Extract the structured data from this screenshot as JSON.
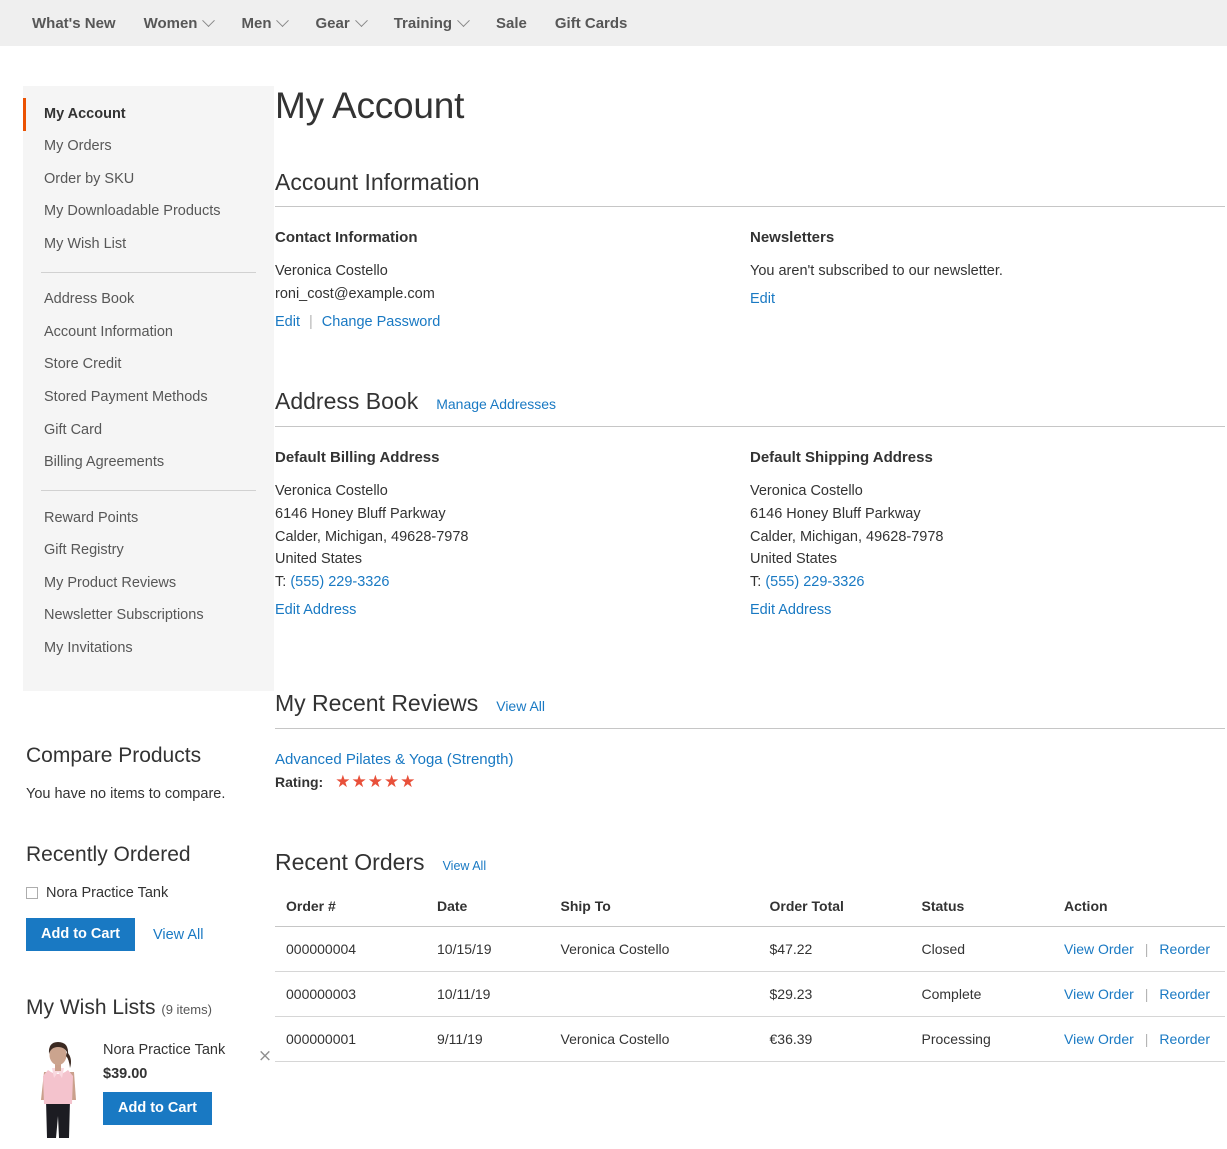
{
  "topnav": {
    "items": [
      {
        "label": "What's New",
        "has_caret": false
      },
      {
        "label": "Women",
        "has_caret": true
      },
      {
        "label": "Men",
        "has_caret": true
      },
      {
        "label": "Gear",
        "has_caret": true
      },
      {
        "label": "Training",
        "has_caret": true
      },
      {
        "label": "Sale",
        "has_caret": false
      },
      {
        "label": "Gift Cards",
        "has_caret": false
      }
    ]
  },
  "account_nav": {
    "group1": [
      "My Account",
      "My Orders",
      "Order by SKU",
      "My Downloadable Products",
      "My Wish List"
    ],
    "group2": [
      "Address Book",
      "Account Information",
      "Store Credit",
      "Stored Payment Methods",
      "Gift Card",
      "Billing Agreements"
    ],
    "group3": [
      "Reward Points",
      "Gift Registry",
      "My Product Reviews",
      "Newsletter Subscriptions",
      "My Invitations"
    ],
    "current": "My Account"
  },
  "compare": {
    "title": "Compare Products",
    "empty_text": "You have no items to compare."
  },
  "recently_ordered": {
    "title": "Recently Ordered",
    "items": [
      {
        "name": "Nora Practice Tank",
        "checked": false
      }
    ],
    "add_to_cart_label": "Add to Cart",
    "view_all_label": "View All"
  },
  "wish_lists": {
    "title": "My Wish Lists",
    "count_label": "(9 items)",
    "items": [
      {
        "name": "Nora Practice Tank",
        "price": "$39.00",
        "add_to_cart_label": "Add to Cart",
        "remove_icon": "×"
      }
    ]
  },
  "main": {
    "page_title": "My Account",
    "account_information": {
      "heading": "Account Information",
      "contact": {
        "title": "Contact Information",
        "name": "Veronica Costello",
        "email": "roni_cost@example.com",
        "edit_label": "Edit",
        "change_password_label": "Change Password"
      },
      "newsletters": {
        "title": "Newsletters",
        "status_text": "You aren't subscribed to our newsletter.",
        "edit_label": "Edit"
      }
    },
    "address_book": {
      "heading": "Address Book",
      "manage_label": "Manage Addresses",
      "billing": {
        "title": "Default Billing Address",
        "name": "Veronica Costello",
        "street": "6146 Honey Bluff Parkway",
        "city_state_zip": "Calder, Michigan, 49628-7978",
        "country": "United States",
        "phone_prefix": "T:",
        "phone": "(555) 229-3326",
        "edit_label": "Edit Address"
      },
      "shipping": {
        "title": "Default Shipping Address",
        "name": "Veronica Costello",
        "street": "6146 Honey Bluff Parkway",
        "city_state_zip": "Calder, Michigan, 49628-7978",
        "country": "United States",
        "phone_prefix": "T:",
        "phone": "(555) 229-3326",
        "edit_label": "Edit Address"
      }
    },
    "recent_reviews": {
      "heading": "My Recent Reviews",
      "view_all_label": "View All",
      "items": [
        {
          "product": "Advanced Pilates & Yoga (Strength)",
          "rating_label": "Rating:",
          "stars": "★★★★★",
          "rating_value": 5
        }
      ]
    },
    "recent_orders": {
      "heading": "Recent Orders",
      "view_all_label": "View All",
      "columns": [
        "Order #",
        "Date",
        "Ship To",
        "Order Total",
        "Status",
        "Action"
      ],
      "rows": [
        {
          "order": "000000004",
          "date": "10/15/19",
          "ship_to": "Veronica Costello",
          "total": "$47.22",
          "status": "Closed",
          "view_label": "View Order",
          "reorder_label": "Reorder"
        },
        {
          "order": "000000003",
          "date": "10/11/19",
          "ship_to": "",
          "total": "$29.23",
          "status": "Complete",
          "view_label": "View Order",
          "reorder_label": "Reorder"
        },
        {
          "order": "000000001",
          "date": "9/11/19",
          "ship_to": "Veronica Costello",
          "total": "€36.39",
          "status": "Processing",
          "view_label": "View Order",
          "reorder_label": "Reorder"
        }
      ]
    }
  },
  "colors": {
    "accent_orange": "#eb5202",
    "link_blue": "#1979c3",
    "star_red": "#e8503a",
    "nav_bg": "#efefef",
    "panel_bg": "#f5f5f5"
  }
}
